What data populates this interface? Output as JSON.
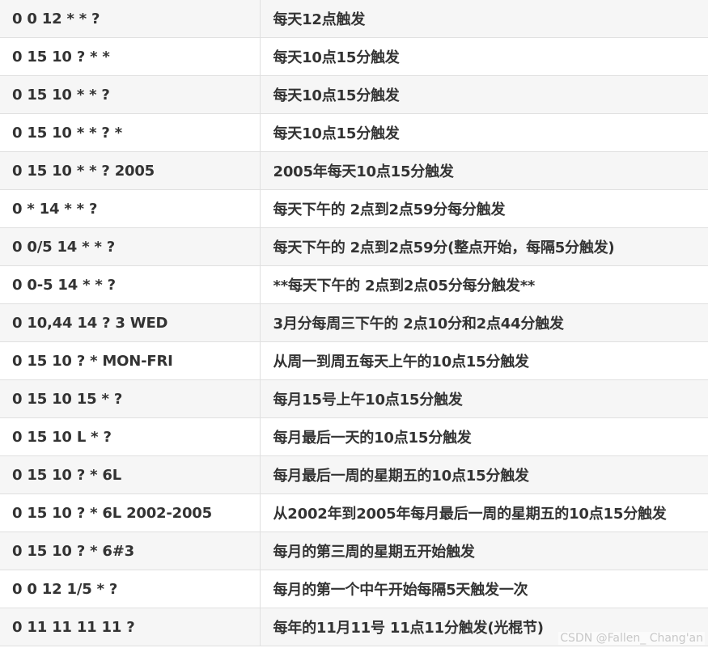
{
  "table": {
    "rows": [
      {
        "expression": "0 0 12 * * ?",
        "description": "每天12点触发"
      },
      {
        "expression": "0 15 10 ? * *",
        "description": "每天10点15分触发"
      },
      {
        "expression": "0 15 10 * * ?",
        "description": "每天10点15分触发"
      },
      {
        "expression": "0 15 10 * * ? *",
        "description": "每天10点15分触发"
      },
      {
        "expression": "0 15 10 * * ? 2005",
        "description": "2005年每天10点15分触发"
      },
      {
        "expression": "0 * 14 * * ?",
        "description": "每天下午的 2点到2点59分每分触发"
      },
      {
        "expression": "0 0/5 14 * * ?",
        "description": "每天下午的 2点到2点59分(整点开始，每隔5分触发)"
      },
      {
        "expression": "0 0-5 14 * * ?",
        "description": "**每天下午的 2点到2点05分每分触发**"
      },
      {
        "expression": "0 10,44 14 ? 3 WED",
        "description": "3月分每周三下午的 2点10分和2点44分触发"
      },
      {
        "expression": "0 15 10 ? * MON-FRI",
        "description": "从周一到周五每天上午的10点15分触发"
      },
      {
        "expression": "0 15 10 15 * ?",
        "description": "每月15号上午10点15分触发"
      },
      {
        "expression": "0 15 10 L * ?",
        "description": "每月最后一天的10点15分触发"
      },
      {
        "expression": "0 15 10 ? * 6L",
        "description": "每月最后一周的星期五的10点15分触发"
      },
      {
        "expression": "0 15 10 ? * 6L 2002-2005",
        "description": "从2002年到2005年每月最后一周的星期五的10点15分触发"
      },
      {
        "expression": "0 15 10 ? * 6#3",
        "description": "每月的第三周的星期五开始触发"
      },
      {
        "expression": "0 0 12 1/5 * ?",
        "description": "每月的第一个中午开始每隔5天触发一次"
      },
      {
        "expression": "0 11 11 11 11 ?",
        "description": "每年的11月11号 11点11分触发(光棍节)"
      }
    ]
  },
  "watermark": "CSDN @Fallen_ Chang'an"
}
